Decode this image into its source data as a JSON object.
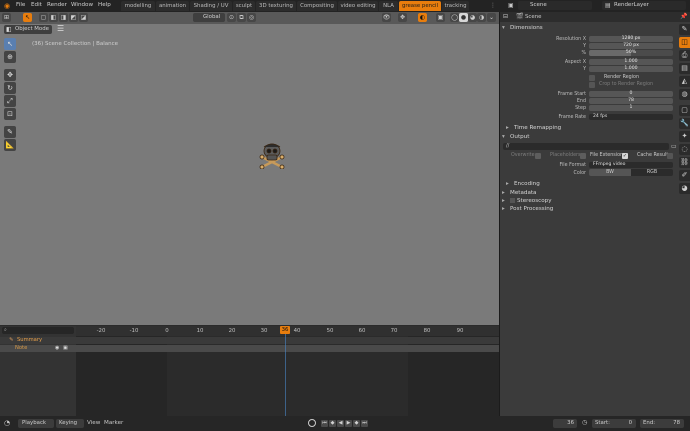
{
  "topbar": {
    "menus": [
      "File",
      "Edit",
      "Render",
      "Window",
      "Help"
    ],
    "workspaces": [
      "modelling",
      "animation",
      "Shading / UV",
      "sculpt",
      "3D texturing",
      "Compositing",
      "video editing",
      "NLA",
      "grease pencil",
      "tracking"
    ],
    "active_workspace": "grease pencil",
    "scene": "Scene",
    "view_layer": "RenderLayer"
  },
  "viewport": {
    "mode": "Object Mode",
    "orientation": "Global",
    "overlay_text": "(36) Scene Collection | Balance"
  },
  "properties": {
    "dimensions": {
      "title": "Dimensions",
      "resolution_x_label": "Resolution X",
      "resolution_x": "1280 px",
      "y_label": "Y",
      "resolution_y": "720 px",
      "pct_label": "%",
      "percentage": "50%",
      "percentage_value": 0.5,
      "aspect_x_label": "Aspect X",
      "aspect_x": "1.000",
      "aspect_y": "1.000",
      "render_region": "Render Region",
      "crop_region": "Crop to Render Region",
      "frame_start_label": "Frame Start",
      "frame_start": "0",
      "end_label": "End",
      "frame_end": "78",
      "step_label": "Step",
      "frame_step": "1",
      "frame_rate_label": "Frame Rate",
      "frame_rate": "24 fps",
      "time_remapping": "Time Remapping"
    },
    "output": {
      "title": "Output",
      "path": "//",
      "overwrite": "Overwrite",
      "placeholders": "Placeholders",
      "file_extensions": "File Extensions",
      "cache_result": "Cache Result",
      "file_format_label": "File Format",
      "file_format": "FFmpeg video",
      "color_label": "Color",
      "color_bw": "BW",
      "color_rgb": "RGB",
      "encoding": "Encoding"
    },
    "metadata": "Metadata",
    "stereoscopy": "Stereoscopy",
    "post_processing": "Post Processing"
  },
  "timeline": {
    "ticks": [
      "-20",
      "-10",
      "0",
      "10",
      "20",
      "30",
      "40",
      "50",
      "60",
      "70",
      "80",
      "90"
    ],
    "current_frame": "36",
    "channels": [
      {
        "label": "Summary"
      },
      {
        "label": "Note"
      }
    ]
  },
  "statusbar": {
    "playback": "Playback",
    "keying": "Keying",
    "view": "View",
    "marker": "Marker",
    "current_frame": "36",
    "start_label": "Start:",
    "start": "0",
    "end_label": "End:",
    "end": "78"
  },
  "colors": {
    "accent": "#e87d0d",
    "viewport_bg": "#7a7a7a",
    "panel_bg": "#3b3b3b"
  }
}
